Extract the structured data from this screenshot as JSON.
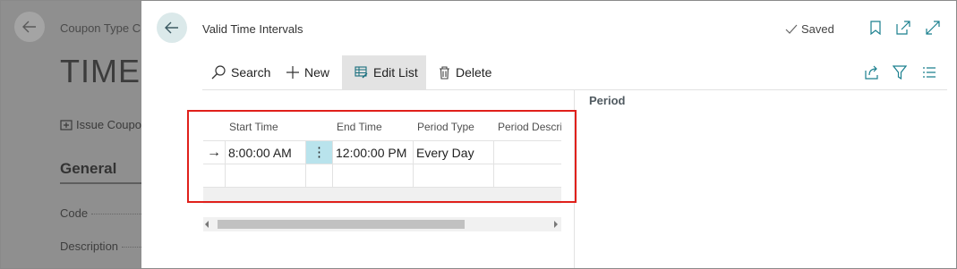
{
  "background_page": {
    "breadcrumb": "Coupon Type C",
    "title": "TIME",
    "action_label": "Issue Coupo",
    "section_title": "General",
    "fields": [
      {
        "label": "Code"
      },
      {
        "label": "Description"
      }
    ]
  },
  "dialog": {
    "title": "Valid Time Intervals",
    "status": "Saved",
    "header_icons": [
      "bookmark-icon",
      "open-new-window-icon",
      "expand-icon"
    ],
    "toolbar": {
      "search_label": "Search",
      "new_label": "New",
      "edit_list_label": "Edit List",
      "delete_label": "Delete"
    },
    "toolbar_right_icons": [
      "share-icon",
      "filter-icon",
      "list-view-icon"
    ],
    "factbox_title": "Period",
    "grid": {
      "columns": [
        "Start Time",
        "End Time",
        "Period Type",
        "Period Descrip"
      ],
      "rows": [
        {
          "start_time": "8:00:00 AM",
          "end_time": "12:00:00 PM",
          "period_type": "Every Day",
          "period_description": ""
        },
        {
          "start_time": "",
          "end_time": "",
          "period_type": "",
          "period_description": ""
        }
      ],
      "row_menu_glyph": "⋮",
      "current_row_glyph": "→"
    }
  },
  "colors": {
    "highlight_border": "#e0201b",
    "selected_cell": "#b9e3ec",
    "back_button": "#dbe9ea",
    "overlay": "#8f8f8f"
  }
}
